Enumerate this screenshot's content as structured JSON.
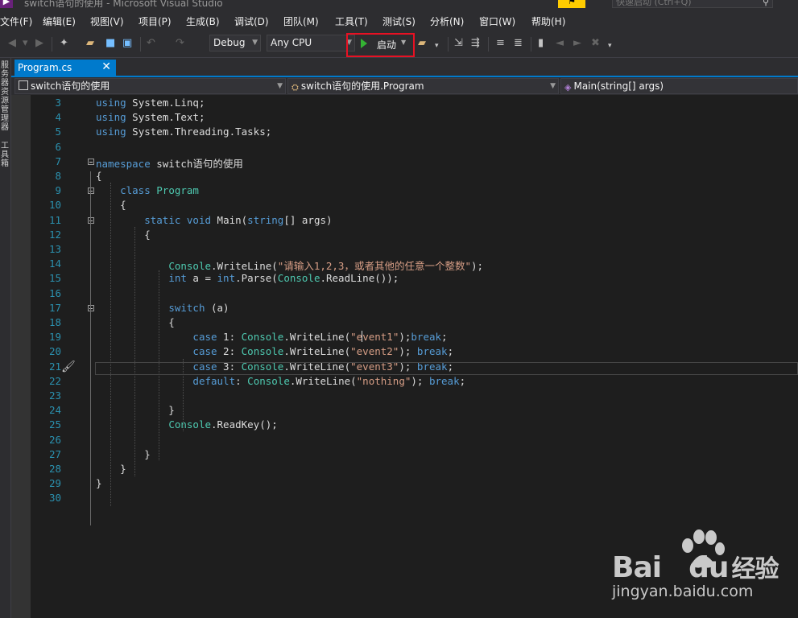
{
  "window": {
    "title": "switch语句的使用 - Microsoft Visual Studio",
    "quick_launch_placeholder": "快速启动 (Ctrl+Q)"
  },
  "menu": [
    "文件(F)",
    "编辑(E)",
    "视图(V)",
    "项目(P)",
    "生成(B)",
    "调试(D)",
    "团队(M)",
    "工具(T)",
    "测试(S)",
    "分析(N)",
    "窗口(W)",
    "帮助(H)"
  ],
  "toolbar": {
    "configuration": "Debug",
    "platform": "Any CPU",
    "start_label": "启动",
    "start_highlight_color": "#e81123"
  },
  "left_panel": {
    "top_label": "服务器资源管理器",
    "bottom_label": "工具箱"
  },
  "tab": {
    "filename": "Program.cs",
    "close": "✕"
  },
  "navbar": {
    "project": "switch语句的使用",
    "class": "switch语句的使用.Program",
    "member": "Main(string[] args)"
  },
  "code": {
    "current_line": 19,
    "lines": [
      {
        "n": "3",
        "t": [
          [
            "kw",
            "using"
          ],
          [
            "tx",
            " System.Linq;"
          ]
        ]
      },
      {
        "n": "4",
        "t": [
          [
            "kw",
            "using"
          ],
          [
            "tx",
            " System.Text;"
          ]
        ]
      },
      {
        "n": "5",
        "t": [
          [
            "kw",
            "using"
          ],
          [
            "tx",
            " System.Threading.Tasks;"
          ]
        ]
      },
      {
        "n": "6",
        "t": []
      },
      {
        "n": "7",
        "t": [
          [
            "kw",
            "namespace"
          ],
          [
            "tx",
            " switch语句的使用"
          ]
        ]
      },
      {
        "n": "8",
        "t": [
          [
            "tx",
            "{"
          ]
        ]
      },
      {
        "n": "9",
        "t": [
          [
            "tx",
            "    "
          ],
          [
            "kw",
            "class"
          ],
          [
            "tx",
            " "
          ],
          [
            "ty",
            "Program"
          ]
        ]
      },
      {
        "n": "10",
        "t": [
          [
            "tx",
            "    {"
          ]
        ]
      },
      {
        "n": "11",
        "t": [
          [
            "tx",
            "        "
          ],
          [
            "kw",
            "static"
          ],
          [
            "tx",
            " "
          ],
          [
            "kw",
            "void"
          ],
          [
            "tx",
            " Main("
          ],
          [
            "kw",
            "string"
          ],
          [
            "tx",
            "[] args)"
          ]
        ]
      },
      {
        "n": "12",
        "t": [
          [
            "tx",
            "        {"
          ]
        ]
      },
      {
        "n": "13",
        "t": []
      },
      {
        "n": "14",
        "t": [
          [
            "tx",
            "            "
          ],
          [
            "ty",
            "Console"
          ],
          [
            "tx",
            ".WriteLine("
          ],
          [
            "str",
            "\"请输入1,2,3，或者其他的任意一个整数\""
          ],
          [
            "tx",
            ");"
          ]
        ]
      },
      {
        "n": "15",
        "t": [
          [
            "tx",
            "            "
          ],
          [
            "kw",
            "int"
          ],
          [
            "tx",
            " a = "
          ],
          [
            "kw",
            "int"
          ],
          [
            "tx",
            ".Parse("
          ],
          [
            "ty",
            "Console"
          ],
          [
            "tx",
            ".ReadLine());"
          ]
        ]
      },
      {
        "n": "16",
        "t": []
      },
      {
        "n": "17",
        "t": [
          [
            "tx",
            "            "
          ],
          [
            "kw",
            "switch"
          ],
          [
            "tx",
            " (a)"
          ]
        ]
      },
      {
        "n": "18",
        "t": [
          [
            "tx",
            "            {"
          ]
        ]
      },
      {
        "n": "19",
        "t": [
          [
            "tx",
            "                "
          ],
          [
            "kw",
            "case"
          ],
          [
            "tx",
            " 1: "
          ],
          [
            "ty",
            "Console"
          ],
          [
            "tx",
            ".WriteLine("
          ],
          [
            "str",
            "\"e"
          ],
          [
            "caret",
            ""
          ],
          [
            "str",
            "vent1\""
          ],
          [
            "tx",
            ");"
          ],
          [
            "kw",
            "break"
          ],
          [
            "tx",
            ";"
          ]
        ]
      },
      {
        "n": "20",
        "t": [
          [
            "tx",
            "                "
          ],
          [
            "kw",
            "case"
          ],
          [
            "tx",
            " 2: "
          ],
          [
            "ty",
            "Console"
          ],
          [
            "tx",
            ".WriteLine("
          ],
          [
            "str",
            "\"event2\""
          ],
          [
            "tx",
            "); "
          ],
          [
            "kw",
            "break"
          ],
          [
            "tx",
            ";"
          ]
        ]
      },
      {
        "n": "21",
        "t": [
          [
            "tx",
            "                "
          ],
          [
            "kw",
            "case"
          ],
          [
            "tx",
            " 3: "
          ],
          [
            "ty",
            "Console"
          ],
          [
            "tx",
            ".WriteLine("
          ],
          [
            "str",
            "\"event3\""
          ],
          [
            "tx",
            "); "
          ],
          [
            "kw",
            "break"
          ],
          [
            "tx",
            ";"
          ]
        ]
      },
      {
        "n": "22",
        "t": [
          [
            "tx",
            "                "
          ],
          [
            "kw",
            "default"
          ],
          [
            "tx",
            ": "
          ],
          [
            "ty",
            "Console"
          ],
          [
            "tx",
            ".WriteLine("
          ],
          [
            "str",
            "\"nothing\""
          ],
          [
            "tx",
            "); "
          ],
          [
            "kw",
            "break"
          ],
          [
            "tx",
            ";"
          ]
        ]
      },
      {
        "n": "23",
        "t": []
      },
      {
        "n": "24",
        "t": [
          [
            "tx",
            "            }"
          ]
        ]
      },
      {
        "n": "25",
        "t": [
          [
            "tx",
            "            "
          ],
          [
            "ty",
            "Console"
          ],
          [
            "tx",
            ".ReadKey();"
          ]
        ]
      },
      {
        "n": "26",
        "t": []
      },
      {
        "n": "27",
        "t": [
          [
            "tx",
            "        }"
          ]
        ]
      },
      {
        "n": "28",
        "t": [
          [
            "tx",
            "    }"
          ]
        ]
      },
      {
        "n": "29",
        "t": [
          [
            "tx",
            "}"
          ]
        ]
      },
      {
        "n": "30",
        "t": []
      }
    ]
  },
  "watermark": {
    "brand": "Bai",
    "brand2": "du",
    "brand3": "经验",
    "url": "jingyan.baidu.com"
  }
}
